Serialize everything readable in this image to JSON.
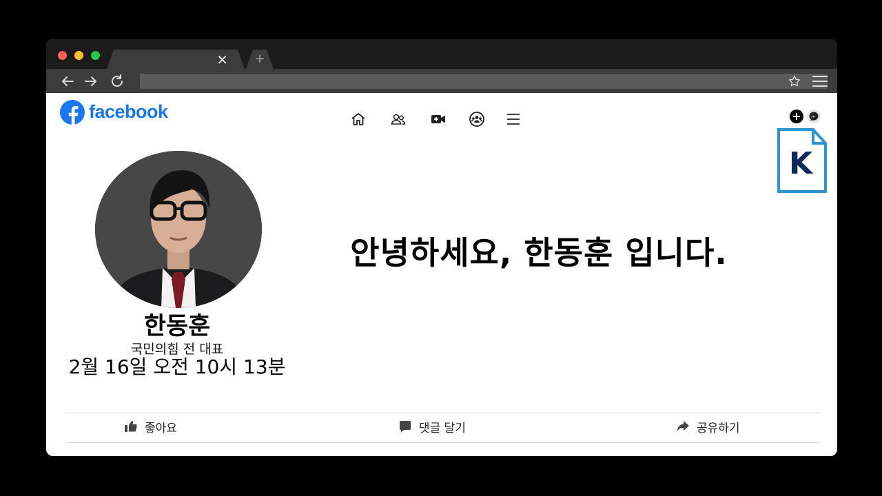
{
  "browser": {
    "tab_close": "×",
    "new_tab": "+"
  },
  "facebook": {
    "brand": "facebook",
    "brand_color": "#1877f2",
    "nav_icons": [
      "home-icon",
      "friends-icon",
      "video-icon",
      "groups-icon",
      "menu-icon"
    ],
    "create_label": "+"
  },
  "post": {
    "author_name": "한동훈",
    "author_title": "국민의힘 전 대표",
    "timestamp": "2월 16일 오전 10시 13분",
    "greeting": "안녕하세요, 한동훈 입니다."
  },
  "actions": {
    "like": "좋아요",
    "comment": "댓글 달기",
    "share": "공유하기"
  },
  "badge": {
    "letter": "K",
    "color": "#2b94d1"
  }
}
